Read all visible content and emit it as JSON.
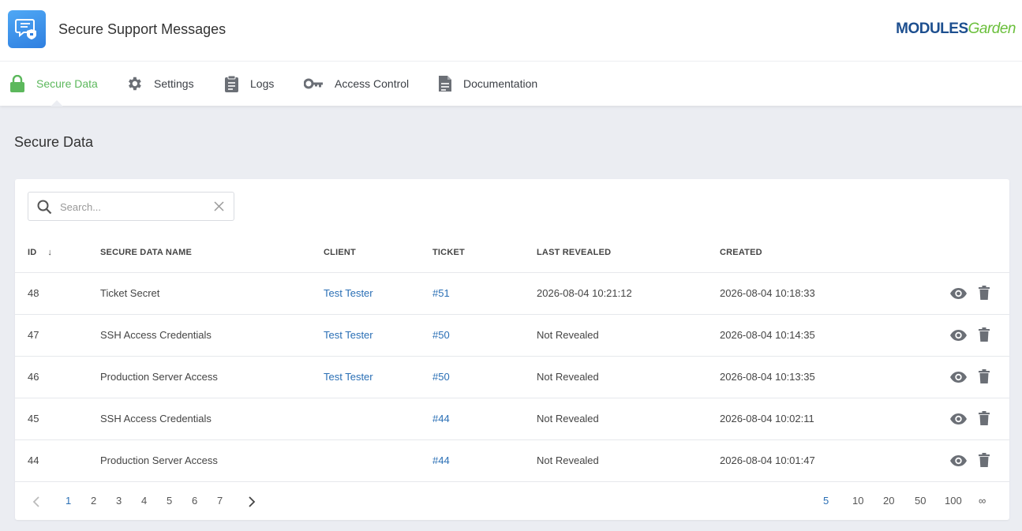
{
  "app": {
    "title": "Secure Support Messages",
    "brand_modules": "MODULES",
    "brand_garden": "Garden"
  },
  "nav": [
    {
      "label": "Secure Data",
      "icon": "lock-icon",
      "active": true
    },
    {
      "label": "Settings",
      "icon": "gear-icon",
      "active": false
    },
    {
      "label": "Logs",
      "icon": "clipboard-icon",
      "active": false
    },
    {
      "label": "Access Control",
      "icon": "key-icon",
      "active": false
    },
    {
      "label": "Documentation",
      "icon": "document-icon",
      "active": false
    }
  ],
  "page": {
    "title": "Secure Data"
  },
  "search": {
    "placeholder": "Search...",
    "value": ""
  },
  "table": {
    "headers": {
      "id": "ID",
      "sort": "↓",
      "name": "Secure Data Name",
      "client": "Client",
      "ticket": "Ticket",
      "last_revealed": "Last Revealed",
      "created": "Created"
    },
    "rows": [
      {
        "id": "48",
        "name": "Ticket Secret",
        "client": "Test Tester",
        "ticket": "#51",
        "last_revealed": "2026-08-04 10:21:12",
        "created": "2026-08-04 10:18:33"
      },
      {
        "id": "47",
        "name": "SSH Access Credentials",
        "client": "Test Tester",
        "ticket": "#50",
        "last_revealed": "Not Revealed",
        "created": "2026-08-04 10:14:35"
      },
      {
        "id": "46",
        "name": "Production Server Access",
        "client": "Test Tester",
        "ticket": "#50",
        "last_revealed": "Not Revealed",
        "created": "2026-08-04 10:13:35"
      },
      {
        "id": "45",
        "name": "SSH Access Credentials",
        "client": "",
        "ticket": "#44",
        "last_revealed": "Not Revealed",
        "created": "2026-08-04 10:02:11"
      },
      {
        "id": "44",
        "name": "Production Server Access",
        "client": "",
        "ticket": "#44",
        "last_revealed": "Not Revealed",
        "created": "2026-08-04 10:01:47"
      }
    ]
  },
  "pagination": {
    "pages": [
      "1",
      "2",
      "3",
      "4",
      "5",
      "6",
      "7"
    ],
    "current_page": "1",
    "page_sizes": [
      "5",
      "10",
      "20",
      "50",
      "100",
      "∞"
    ],
    "current_size": "5"
  },
  "colors": {
    "accent_green": "#5cb85c",
    "link_blue": "#2a6fb5",
    "background": "#ebedf2"
  }
}
